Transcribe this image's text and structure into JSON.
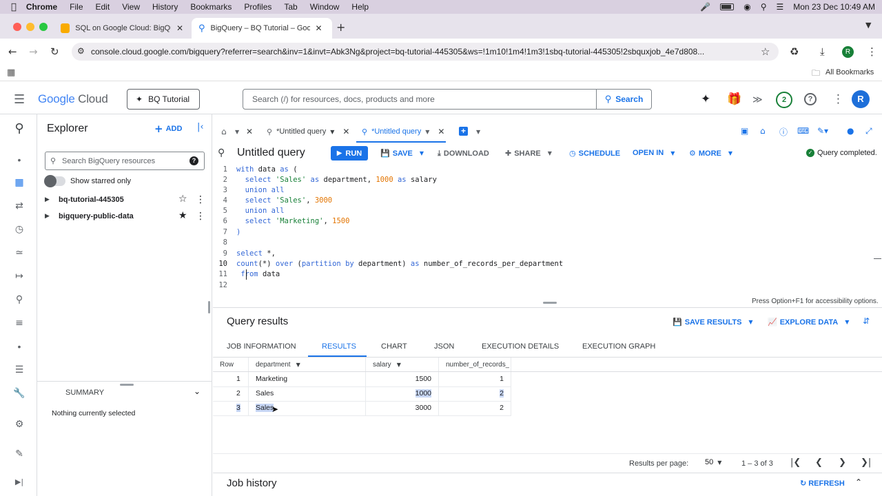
{
  "menubar": {
    "app": "Chrome",
    "items": [
      "File",
      "Edit",
      "View",
      "History",
      "Bookmarks",
      "Profiles",
      "Tab",
      "Window",
      "Help"
    ],
    "clock": "Mon 23 Dec  10:49 AM"
  },
  "browser": {
    "tabs": [
      {
        "title": "SQL on Google Cloud: BigQu"
      },
      {
        "title": "BigQuery – BQ Tutorial – Goo"
      }
    ],
    "url": "console.cloud.google.com/bigquery?referrer=search&inv=1&invt=Abk3Ng&project=bq-tutorial-445305&ws=!1m10!1m4!1m3!1sbq-tutorial-445305!2sbquxjob_4e7d808...",
    "all_bookmarks": "All Bookmarks",
    "profile_initial": "R"
  },
  "gcp": {
    "logo_google": "Google",
    "logo_cloud": "Cloud",
    "project": "BQ Tutorial",
    "search_placeholder": "Search (/) for resources, docs, products and more",
    "search_button": "Search",
    "notif_count": "2",
    "avatar": "R"
  },
  "explorer": {
    "title": "Explorer",
    "add": "ADD",
    "search_placeholder": "Search BigQuery resources",
    "starred_toggle": "Show starred only",
    "projects": [
      {
        "name": "bq-tutorial-445305"
      },
      {
        "name": "bigquery-public-data"
      }
    ],
    "summary_title": "SUMMARY",
    "summary_text": "Nothing currently selected"
  },
  "editor": {
    "tabs": [
      {
        "title": "*Untitled query"
      },
      {
        "title": "*Untitled query"
      }
    ],
    "query_title": "Untitled query",
    "toolbar": {
      "run": "RUN",
      "save": "SAVE",
      "download": "DOWNLOAD",
      "share": "SHARE",
      "schedule": "SCHEDULE",
      "open_in": "OPEN IN",
      "more": "MORE",
      "status": "Query completed."
    },
    "code_lines": [
      {
        "n": "1",
        "t": "with data as ("
      },
      {
        "n": "2",
        "t": "  select 'Sales' as department, 1000 as salary"
      },
      {
        "n": "3",
        "t": "  union all"
      },
      {
        "n": "4",
        "t": "  select 'Sales', 3000"
      },
      {
        "n": "5",
        "t": "  union all"
      },
      {
        "n": "6",
        "t": "  select 'Marketing', 1500"
      },
      {
        "n": "7",
        "t": ")"
      },
      {
        "n": "8",
        "t": ""
      },
      {
        "n": "9",
        "t": "select *,"
      },
      {
        "n": "10",
        "t": "count(*) over (partition by department) as number_of_records_per_department"
      },
      {
        "n": "11",
        "t": " from data"
      },
      {
        "n": "12",
        "t": ""
      }
    ],
    "a11y_hint": "Press Option+F1 for accessibility options."
  },
  "results": {
    "title": "Query results",
    "save_results": "SAVE RESULTS",
    "explore_data": "EXPLORE DATA",
    "tabs": [
      "JOB INFORMATION",
      "RESULTS",
      "CHART",
      "JSON",
      "EXECUTION DETAILS",
      "EXECUTION GRAPH"
    ],
    "columns": [
      "Row",
      "department",
      "salary",
      "number_of_records_"
    ],
    "rows": [
      {
        "row": "1",
        "department": "Marketing",
        "salary": "1500",
        "count": "1"
      },
      {
        "row": "2",
        "department": "Sales",
        "salary": "1000",
        "count": "2"
      },
      {
        "row": "3",
        "department": "Sales",
        "salary": "3000",
        "count": "2"
      }
    ],
    "per_page_label": "Results per page:",
    "per_page": "50",
    "range": "1 – 3 of 3"
  },
  "job_history": {
    "title": "Job history",
    "refresh": "REFRESH"
  },
  "colors": {
    "blue": "#1a73e8",
    "green": "#188038",
    "selection": "#c8d7f5"
  }
}
